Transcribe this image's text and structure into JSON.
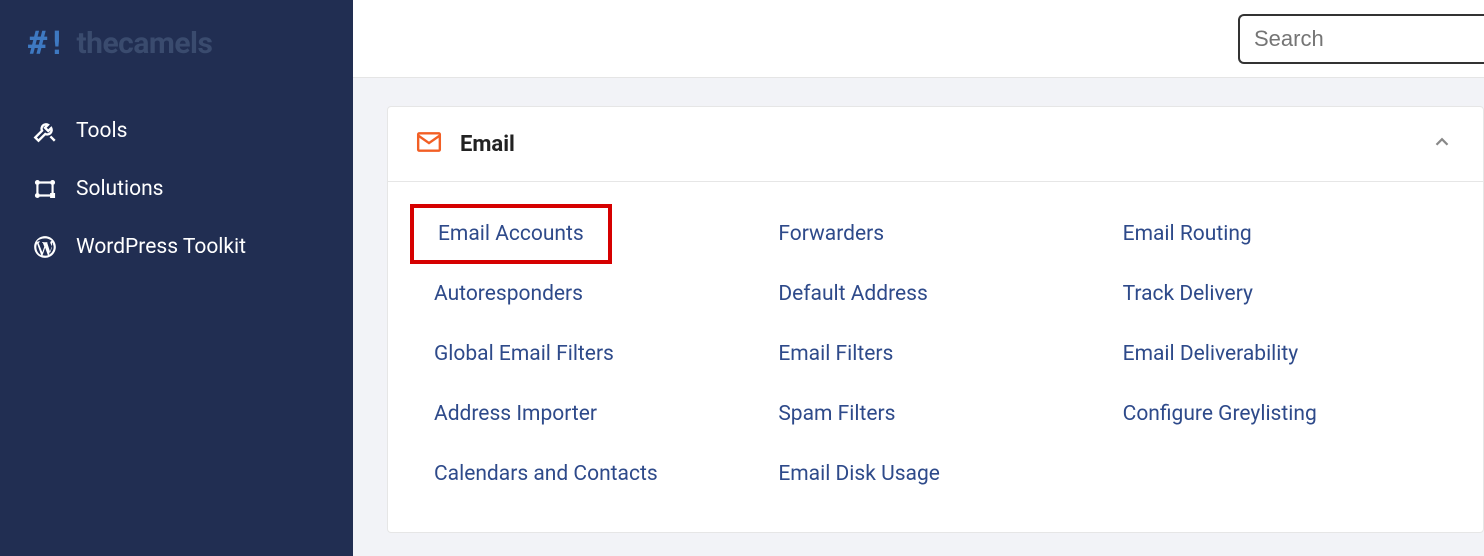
{
  "brand": {
    "mark": "#!",
    "text": "thecamels"
  },
  "sidebar": {
    "items": [
      {
        "label": "Tools",
        "icon": "tools"
      },
      {
        "label": "Solutions",
        "icon": "solutions"
      },
      {
        "label": "WordPress Toolkit",
        "icon": "wordpress"
      }
    ]
  },
  "search": {
    "placeholder": "Search"
  },
  "panel": {
    "title": "Email",
    "columns": [
      [
        {
          "label": "Email Accounts",
          "highlighted": true
        },
        {
          "label": "Autoresponders"
        },
        {
          "label": "Global Email Filters"
        },
        {
          "label": "Address Importer"
        },
        {
          "label": "Calendars and Contacts"
        }
      ],
      [
        {
          "label": "Forwarders"
        },
        {
          "label": "Default Address"
        },
        {
          "label": "Email Filters"
        },
        {
          "label": "Spam Filters"
        },
        {
          "label": "Email Disk Usage"
        }
      ],
      [
        {
          "label": "Email Routing"
        },
        {
          "label": "Track Delivery"
        },
        {
          "label": "Email Deliverability"
        },
        {
          "label": "Configure Greylisting"
        }
      ]
    ]
  }
}
